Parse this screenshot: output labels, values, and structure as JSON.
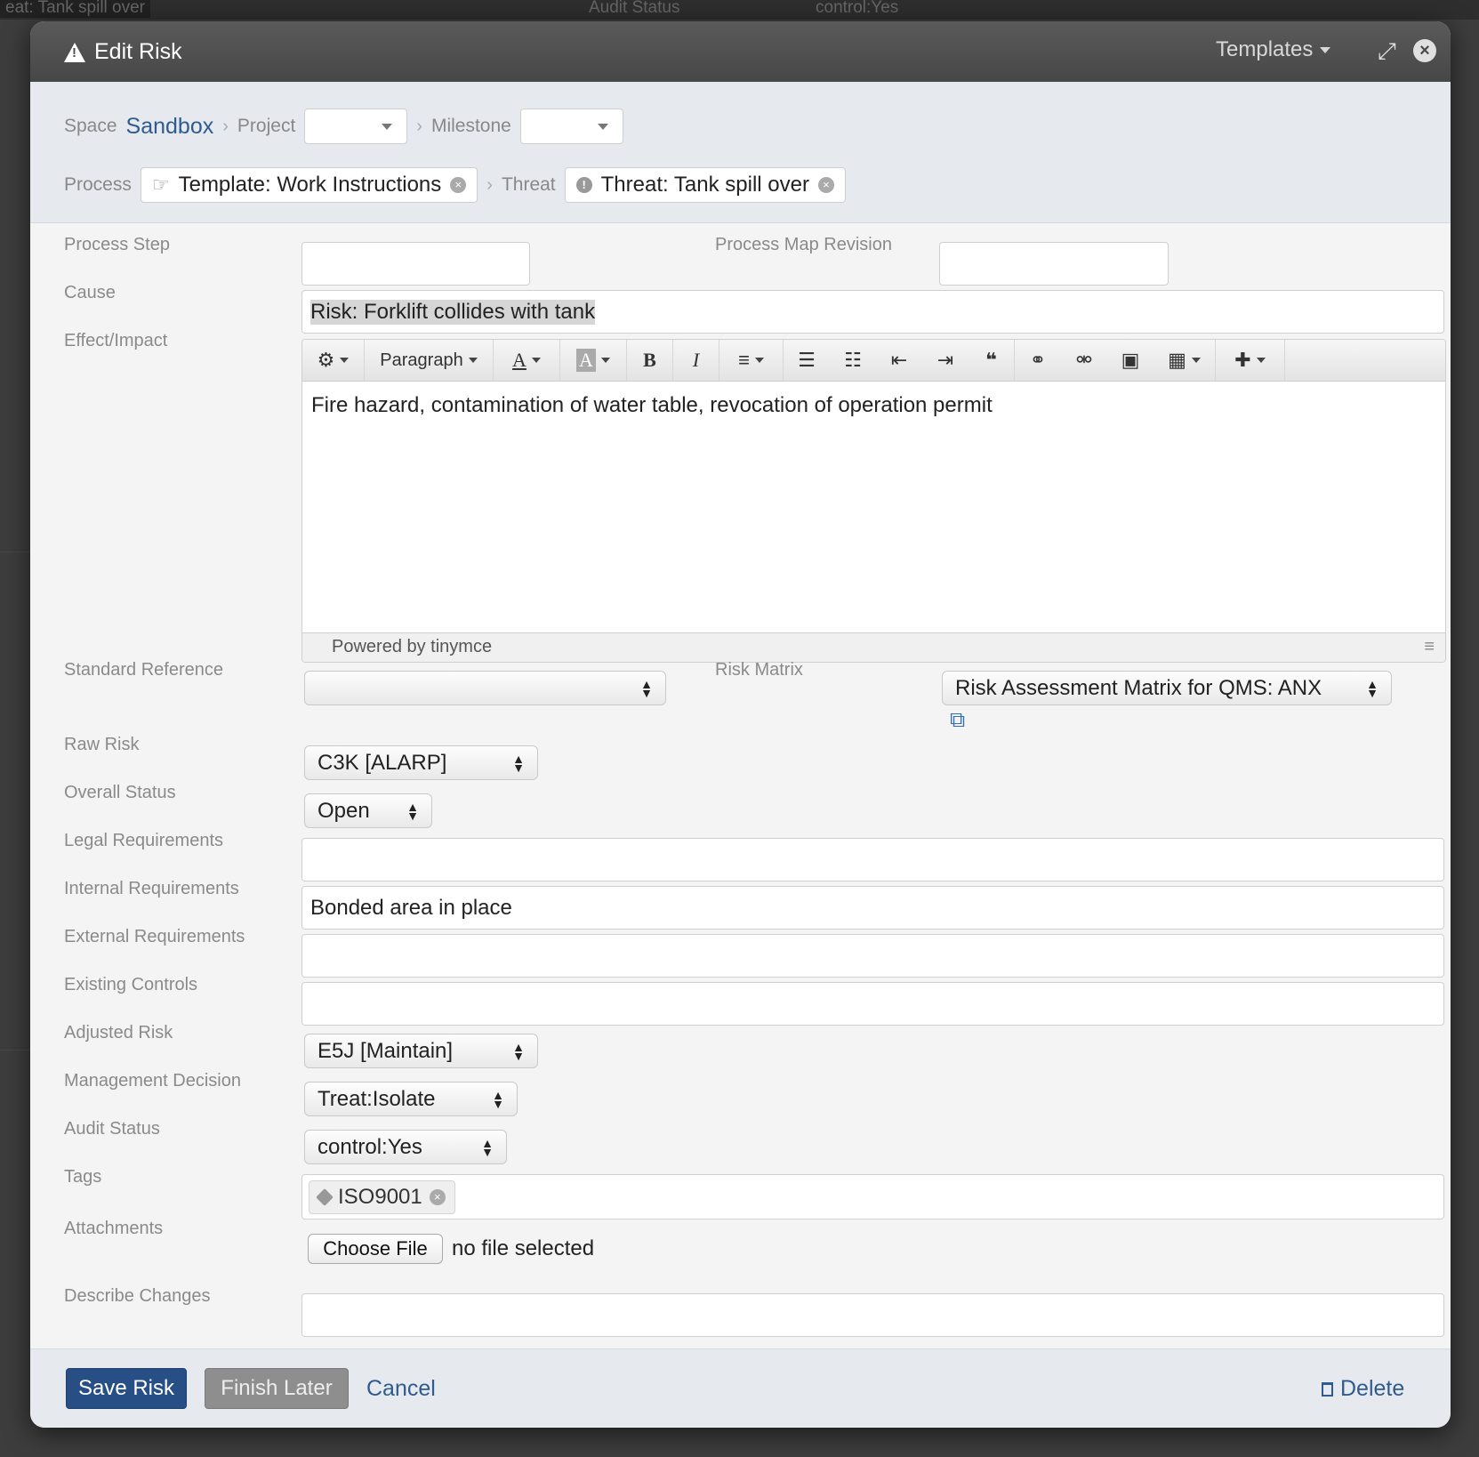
{
  "dialog": {
    "title": "Edit Risk",
    "templates_label": "Templates"
  },
  "context": {
    "space_label": "Space",
    "space_value": "Sandbox",
    "project_label": "Project",
    "project_value": "",
    "milestone_label": "Milestone",
    "milestone_value": "",
    "process_label": "Process",
    "process_value": "Template: Work Instructions",
    "threat_label": "Threat",
    "threat_value": "Threat: Tank spill over"
  },
  "fields": {
    "process_step": {
      "label": "Process Step",
      "value": ""
    },
    "process_map_revision": {
      "label": "Process Map Revision",
      "value": ""
    },
    "cause": {
      "label": "Cause",
      "value": "Risk: Forklift collides with tank"
    },
    "effect": {
      "label": "Effect/Impact",
      "value": "Fire hazard, contamination of water table, revocation of operation permit"
    },
    "standard_reference": {
      "label": "Standard Reference",
      "value": ""
    },
    "risk_matrix": {
      "label": "Risk Matrix",
      "value": "Risk Assessment Matrix for QMS: ANX"
    },
    "raw_risk": {
      "label": "Raw Risk",
      "value": "C3K [ALARP]"
    },
    "overall_status": {
      "label": "Overall Status",
      "value": "Open"
    },
    "legal_requirements": {
      "label": "Legal Requirements",
      "value": ""
    },
    "internal_requirements": {
      "label": "Internal Requirements",
      "value": "Bonded area in place"
    },
    "external_requirements": {
      "label": "External Requirements",
      "value": ""
    },
    "existing_controls": {
      "label": "Existing Controls",
      "value": ""
    },
    "adjusted_risk": {
      "label": "Adjusted Risk",
      "value": "E5J [Maintain]"
    },
    "management_decision": {
      "label": "Management Decision",
      "value": "Treat:Isolate"
    },
    "audit_status": {
      "label": "Audit Status",
      "value": "control:Yes"
    },
    "tags": {
      "label": "Tags",
      "items": [
        "ISO9001"
      ]
    },
    "attachments": {
      "label": "Attachments",
      "button": "Choose File",
      "status": "no file selected"
    },
    "describe_changes": {
      "label": "Describe Changes",
      "value": ""
    }
  },
  "editor": {
    "toolbar": {
      "format": "Paragraph"
    },
    "powered_by": "Powered by tinymce"
  },
  "footer": {
    "save": "Save Risk",
    "finish_later": "Finish Later",
    "cancel": "Cancel",
    "delete": "Delete"
  },
  "background": {
    "top_left": "eat: Tank spill over",
    "top_mid": "Audit Status",
    "top_right": "control:Yes"
  },
  "colors": {
    "primary": "#274f86",
    "link": "#2f5b8f",
    "titlebar": "#4d4d4d",
    "context_bg": "#e6eaef"
  }
}
